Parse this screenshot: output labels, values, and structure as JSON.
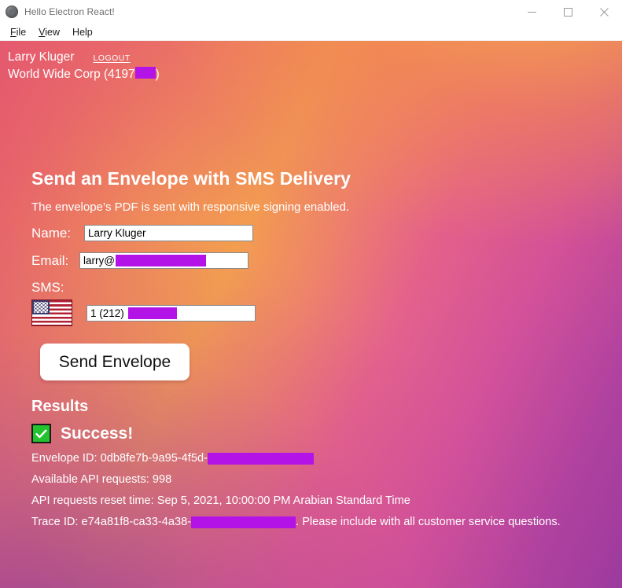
{
  "window": {
    "title": "Hello Electron React!",
    "icon": "app-icon",
    "controls": {
      "minimize": "minimize-icon",
      "maximize": "maximize-icon",
      "close": "close-icon"
    }
  },
  "menubar": {
    "items": [
      {
        "label": "File",
        "accel": "F",
        "rest": "ile"
      },
      {
        "label": "View",
        "accel": "V",
        "rest": "iew"
      },
      {
        "label": "Help",
        "accel": "",
        "rest": "Help"
      }
    ]
  },
  "account": {
    "user_name": "Larry Kluger",
    "logout_label": "LOGOUT",
    "org_prefix": "World Wide Corp (4197",
    "org_suffix": ")"
  },
  "form": {
    "title": "Send an Envelope with SMS Delivery",
    "subtitle": "The envelope’s PDF is sent with responsive signing enabled.",
    "name_label": "Name:",
    "name_value": "Larry Kluger",
    "email_label": "Email:",
    "email_value": "larry@",
    "sms_label": "SMS:",
    "flag_icon": "us-flag-icon",
    "phone_value": "1 (212)",
    "submit_label": "Send Envelope"
  },
  "results": {
    "title": "Results",
    "status_icon": "green-check-icon",
    "status_text": "Success!",
    "envelope_id_label": "Envelope ID: 0db8fe7b-9a95-4f5d-",
    "api_requests_line": "Available API requests: 998",
    "reset_time_line": "API requests reset time: Sep 5, 2021, 10:00:00 PM Arabian Standard Time",
    "trace_id_label": "Trace ID: e74a81f8-ca33-4a38-",
    "trace_id_suffix": ". Please include with all customer service questions."
  },
  "colors": {
    "redaction": "#b413e8",
    "success_green": "#22c32e",
    "gradient_start": "#f3a04e",
    "gradient_mid": "#e3566f",
    "gradient_end": "#9c3a9e"
  }
}
